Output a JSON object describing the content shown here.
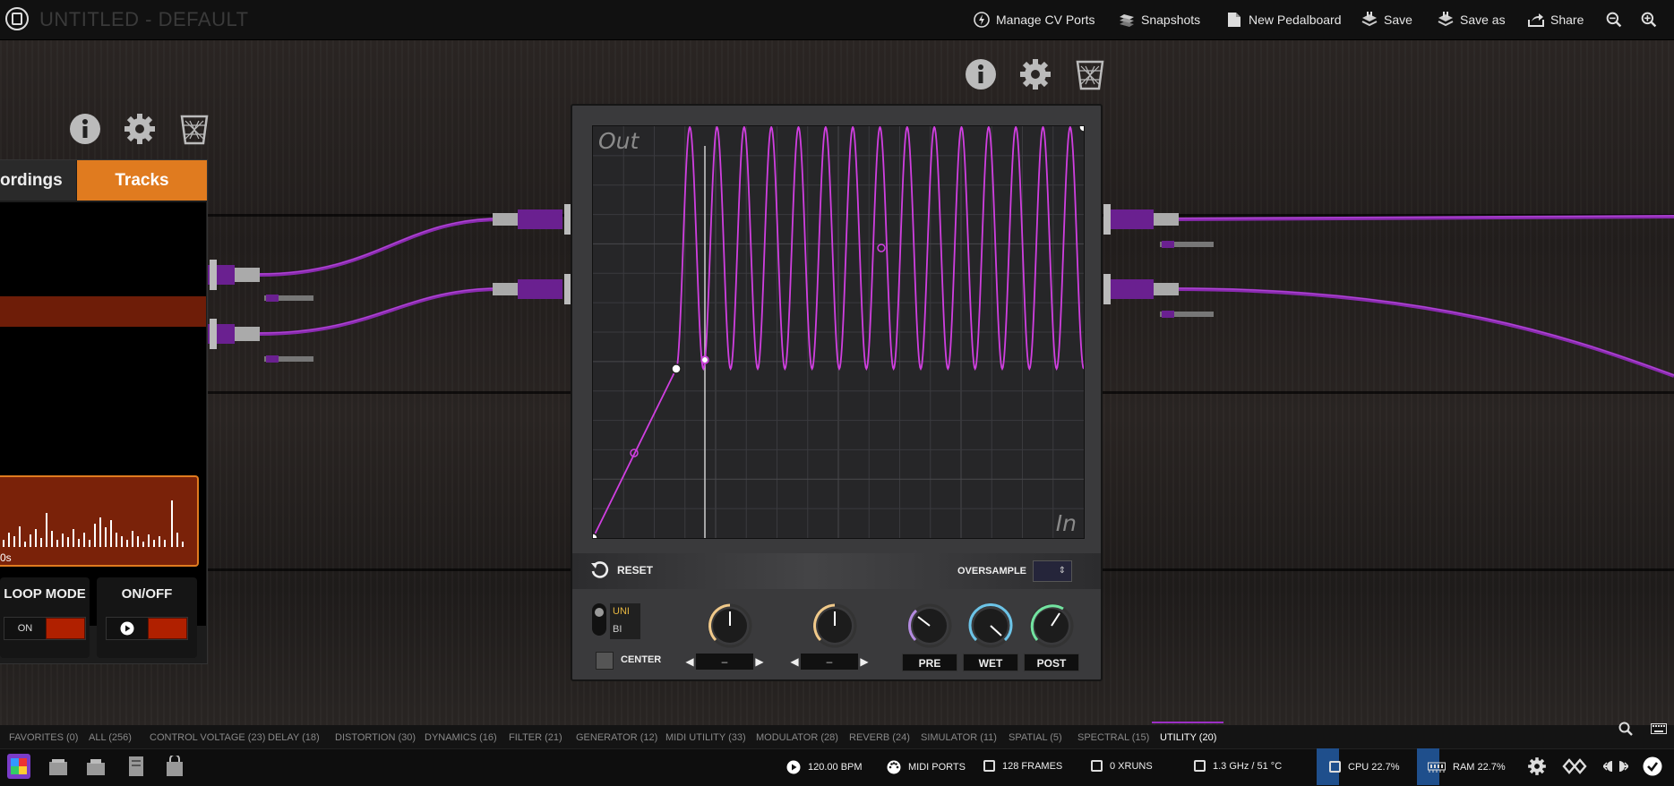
{
  "app": {
    "title": "UNTITLED - DEFAULT",
    "toolbar": {
      "cv_ports": "Manage CV Ports",
      "snapshots": "Snapshots",
      "new_pedalboard": "New Pedalboard",
      "save": "Save",
      "save_as": "Save as",
      "share": "Share"
    }
  },
  "left_plugin": {
    "tab_recordings": "ordings",
    "tab_tracks": "Tracks",
    "waveform_label": "0s",
    "loop_mode": {
      "title": "LOOP MODE",
      "state": "ON"
    },
    "on_off": {
      "title": "ON/OFF"
    }
  },
  "shaper_plugin": {
    "axis_out": "Out",
    "axis_in": "In",
    "reset_label": "RESET",
    "oversample_label": "OVERSAMPLE",
    "oversample_value": "",
    "mode_uni": "UNI",
    "mode_bi": "BI",
    "center_label": "CENTER",
    "stepper1_value": "–",
    "stepper2_value": "–",
    "knob_labels": [
      "PRE",
      "WET",
      "POST"
    ],
    "accent_color": "#d03fe0"
  },
  "categories": [
    "FAVORITES (0)",
    "ALL (256)",
    "CONTROL VOLTAGE (23)",
    "DELAY (18)",
    "DISTORTION (30)",
    "DYNAMICS (16)",
    "FILTER (21)",
    "GENERATOR (12)",
    "MIDI UTILITY (33)",
    "MODULATOR (28)",
    "REVERB (24)",
    "SIMULATOR (11)",
    "SPATIAL (5)",
    "SPECTRAL (15)",
    "UTILITY (20)"
  ],
  "active_category": "UTILITY (20)",
  "status": {
    "bpm": "120.00 BPM",
    "midi": "MIDI PORTS",
    "frames": "128 FRAMES",
    "xruns": "0 XRUNS",
    "clock": "1.3 GHz / 51 °C",
    "cpu": "CPU 22.7%",
    "cpu_value": 22.7,
    "ram": "RAM 22.7%",
    "ram_value": 22.7
  }
}
